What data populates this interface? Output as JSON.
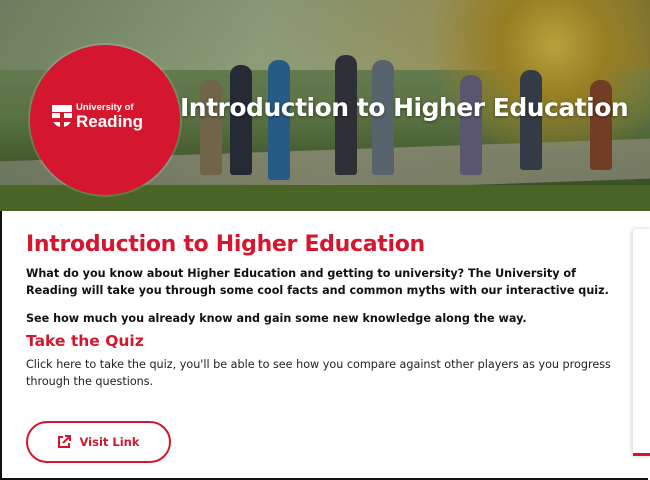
{
  "hero": {
    "logo": {
      "line1": "University of",
      "line2": "Reading",
      "icon": "university-crest-icon"
    },
    "title": "Introduction to Higher Education"
  },
  "main": {
    "heading": "Introduction to Higher Education",
    "intro": "What do you know about Higher Education and getting to university? The University of Reading will take you through some cool facts and common myths with our interactive quiz.",
    "intro2": "See how much you already know and gain some new knowledge along the way.",
    "quiz_heading": "Take the Quiz",
    "quiz_description": "Click here to take the quiz, you'll be able to see how you compare against other players as you progress through the questions.",
    "visit_button": {
      "label": "Visit Link",
      "icon": "external-link-icon"
    }
  },
  "colors": {
    "brand_red": "#d4172e",
    "text": "#111111"
  }
}
